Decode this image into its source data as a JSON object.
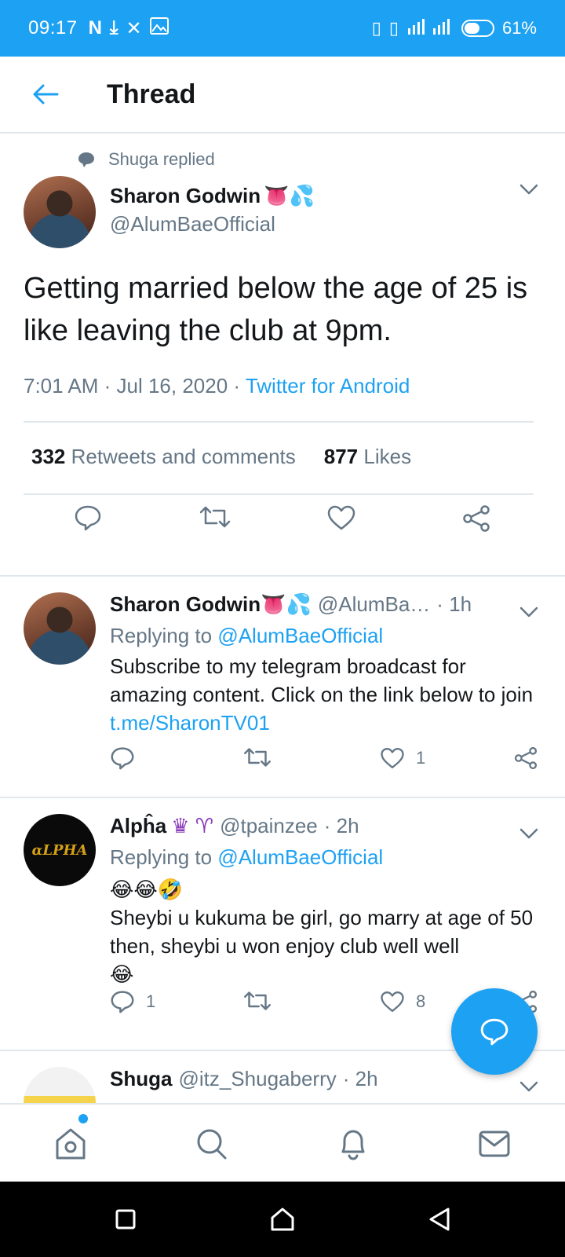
{
  "status_bar": {
    "time": "09:17",
    "left_icons": [
      "netflix-icon",
      "download-icon",
      "x-icon",
      "image-icon"
    ],
    "battery": "61%",
    "battery_level": 0.61
  },
  "header": {
    "title": "Thread"
  },
  "main_tweet": {
    "context": "Shuga replied",
    "author_name": "Sharon Godwin",
    "author_emoji": "👅💦",
    "handle": "@AlumBaeOfficial",
    "text": "Getting married below the age of 25 is like leaving the club at 9pm.",
    "time": "7:01 AM",
    "date": "Jul 16, 2020",
    "source": "Twitter for Android",
    "retweets_count": "332",
    "retweets_label": "Retweets and comments",
    "likes_count": "877",
    "likes_label": "Likes"
  },
  "replies": [
    {
      "name": "Sharon Godwin",
      "emoji": "👅💦",
      "handle": "@AlumBa…",
      "time": "1h",
      "replying_label": "Replying to",
      "replying_to": "@AlumBaeOfficial",
      "text": "Subscribe to my telegram broadcast for amazing content. Click on the link below to join",
      "link": "t.me/SharonTV01",
      "comments": "",
      "likes": "1"
    },
    {
      "name": "Alpĥa",
      "emoji": "♛ ♈",
      "handle": "@tpainzee",
      "time": "2h",
      "replying_label": "Replying to",
      "replying_to": "@AlumBaeOfficial",
      "emoji_line": "😂😂🤣",
      "text": "Sheybi u kukuma be girl, go marry at age of 50 then, sheybi u won enjoy club well well",
      "text_end": "😂",
      "comments": "1",
      "likes": "8",
      "avatar_text": "αLPHA"
    },
    {
      "name": "Shuga",
      "handle": "@itz_Shugaberry",
      "time": "2h"
    }
  ],
  "colors": {
    "accent": "#1da1f2",
    "text": "#14171a",
    "secondary": "#657786",
    "border": "#e1e8ed"
  }
}
